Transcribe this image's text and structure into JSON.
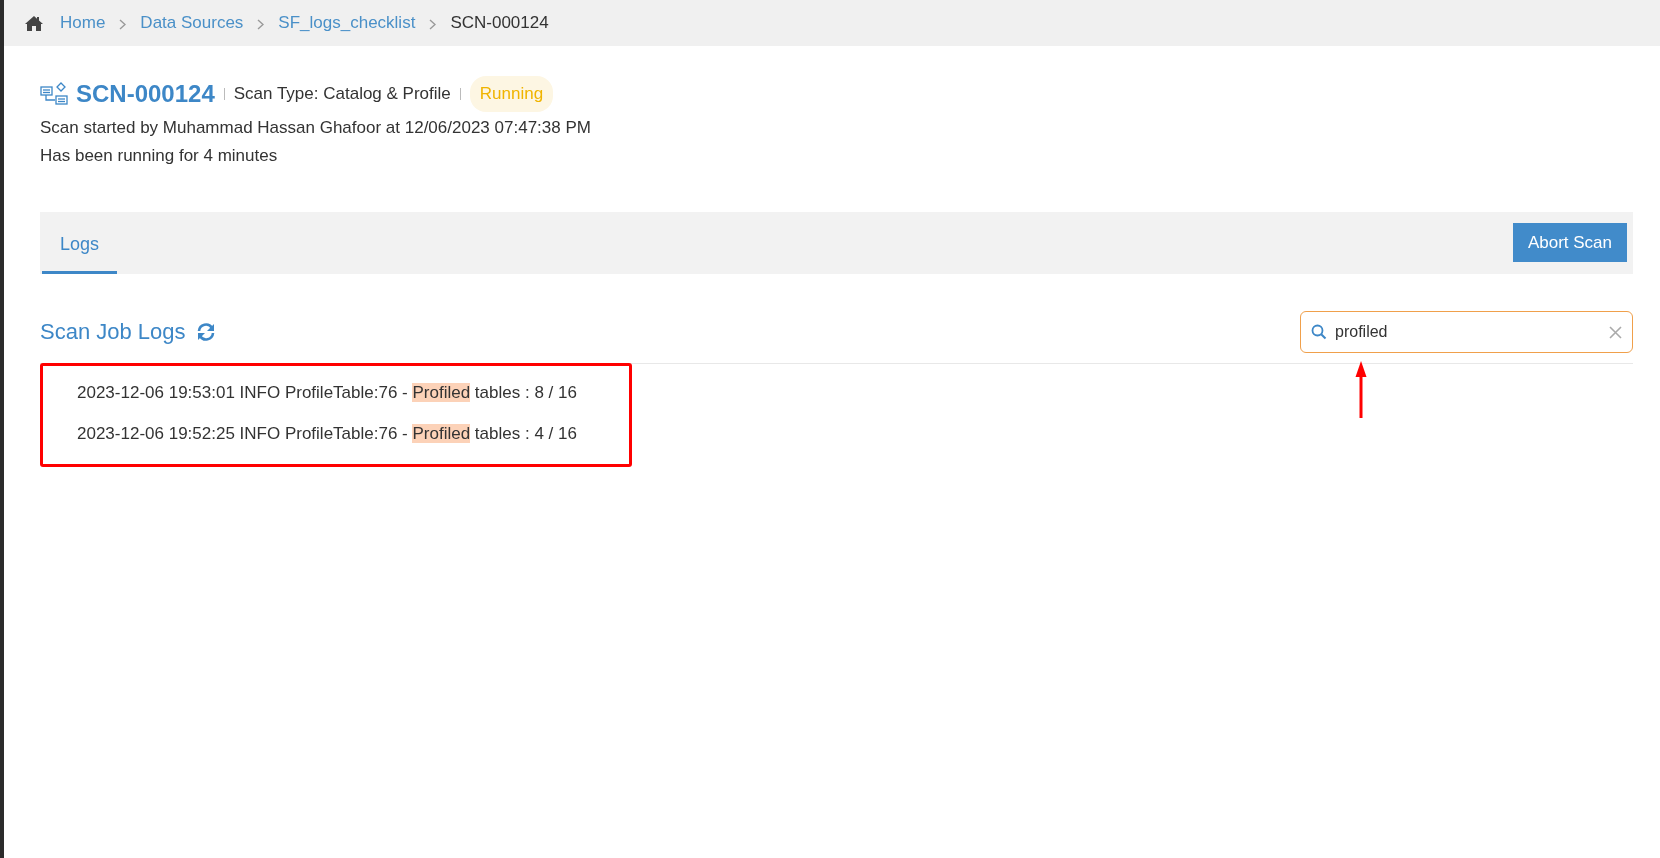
{
  "breadcrumb": [
    {
      "label": "Home",
      "link": true
    },
    {
      "label": "Data Sources",
      "link": true
    },
    {
      "label": "SF_logs_checklist",
      "link": true
    },
    {
      "label": "SCN-000124",
      "link": false
    }
  ],
  "scan": {
    "id": "SCN-000124",
    "type": "Scan Type: Catalog & Profile",
    "status": "Running",
    "started": "Scan started by Muhammad Hassan Ghafoor at 12/06/2023 07:47:38 PM",
    "duration": "Has been running for 4 minutes"
  },
  "tabs": [
    {
      "label": "Logs",
      "selected": true
    }
  ],
  "abort_button": "Abort Scan",
  "logs_section": {
    "title": "Scan Job Logs",
    "search": {
      "value": "profiled"
    },
    "entries": [
      {
        "parts": [
          {
            "text": "2023-12-06 19:53:01 INFO ProfileTable:76 - ",
            "highlighted": false
          },
          {
            "text": "Profiled",
            "highlighted": true
          },
          {
            "text": " tables : 8 / 16",
            "highlighted": false
          }
        ]
      },
      {
        "parts": [
          {
            "text": "2023-12-06 19:52:25 INFO ProfileTable:76 - ",
            "highlighted": false
          },
          {
            "text": "Profiled",
            "highlighted": true
          },
          {
            "text": " tables : 4 / 16",
            "highlighted": false
          }
        ]
      }
    ]
  },
  "annotations": {
    "box_around_logs": true,
    "arrow_to_search": true
  }
}
